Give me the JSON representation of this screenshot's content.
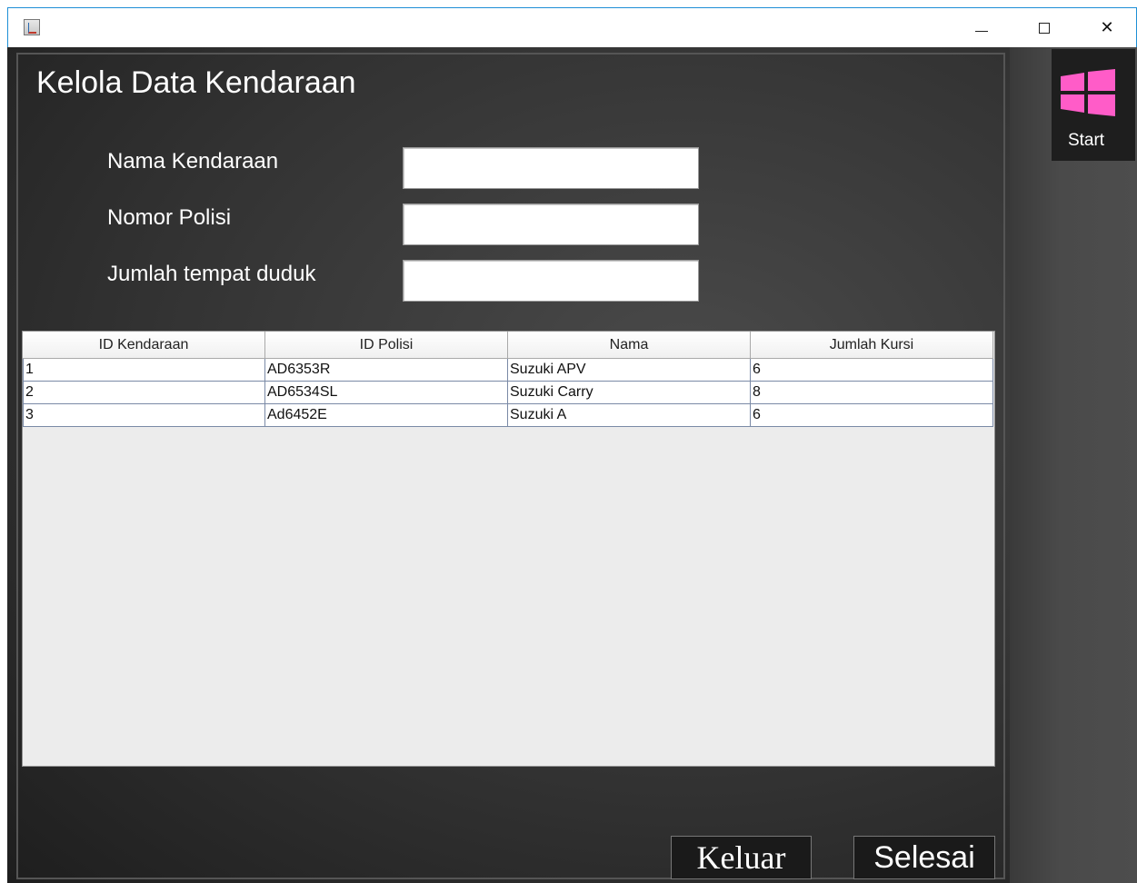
{
  "window": {
    "icon": "java-app-icon",
    "controls": {
      "minimize": "minimize-icon",
      "maximize": "maximize-icon",
      "close": "close-icon",
      "close_glyph": "✕"
    }
  },
  "page": {
    "title": "Kelola Data Kendaraan"
  },
  "form": {
    "nama_kendaraan": {
      "label": "Nama Kendaraan",
      "value": "",
      "placeholder": ""
    },
    "nomor_polisi": {
      "label": "Nomor Polisi",
      "value": "",
      "placeholder": ""
    },
    "jumlah_tempat_duduk": {
      "label": "Jumlah tempat duduk",
      "value": "",
      "placeholder": ""
    }
  },
  "table": {
    "columns": [
      "ID Kendaraan",
      "ID Polisi",
      "Nama",
      "Jumlah Kursi"
    ],
    "rows": [
      [
        "1",
        "AD6353R",
        "Suzuki APV",
        "6"
      ],
      [
        "2",
        "AD6534SL",
        "Suzuki Carry",
        "8"
      ],
      [
        "3",
        "Ad6452E",
        "Suzuki A",
        "6"
      ]
    ]
  },
  "sidebar": {
    "start_label": "Start",
    "start_icon": "windows-logo-icon",
    "start_icon_color": "#ff5cc8"
  },
  "actions": {
    "keluar_label": "Keluar",
    "selesai_label": "Selesai"
  },
  "colors": {
    "background_dark": "#333333",
    "accent_pink": "#ff5cc8",
    "title_border": "#1e8fd6"
  }
}
